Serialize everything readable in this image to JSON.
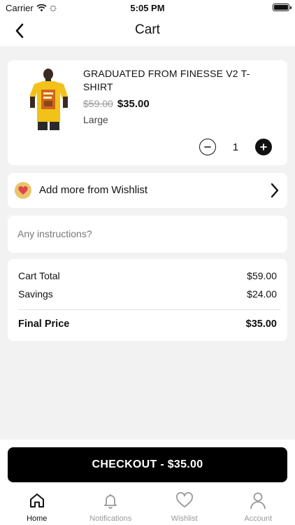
{
  "status_bar": {
    "carrier": "Carrier",
    "time": "5:05 PM"
  },
  "nav": {
    "title": "Cart"
  },
  "cart_item": {
    "name": "GRADUATED FROM FINESSE V2 T-SHIRT",
    "original_price": "$59.00",
    "price": "$35.00",
    "variant": "Large",
    "quantity": "1",
    "image_icon": "yellow-tshirt-photo"
  },
  "wishlist": {
    "label": "Add more from Wishlist"
  },
  "instructions": {
    "placeholder": "Any instructions?"
  },
  "totals": {
    "cart_total_label": "Cart Total",
    "cart_total_value": "$59.00",
    "savings_label": "Savings",
    "savings_value": "$24.00",
    "final_label": "Final Price",
    "final_value": "$35.00"
  },
  "checkout": {
    "label": "CHECKOUT - $35.00"
  },
  "tabs": [
    {
      "label": "Home",
      "icon": "home-icon",
      "active": true
    },
    {
      "label": "Notifications",
      "icon": "bell-icon",
      "active": false
    },
    {
      "label": "Wishlist",
      "icon": "heart-icon",
      "active": false
    },
    {
      "label": "Account",
      "icon": "user-icon",
      "active": false
    }
  ],
  "colors": {
    "accent": "#000000",
    "background": "#f2f2f2",
    "muted": "#999999",
    "badge": "#e9c46a",
    "heart": "#e0474c"
  }
}
